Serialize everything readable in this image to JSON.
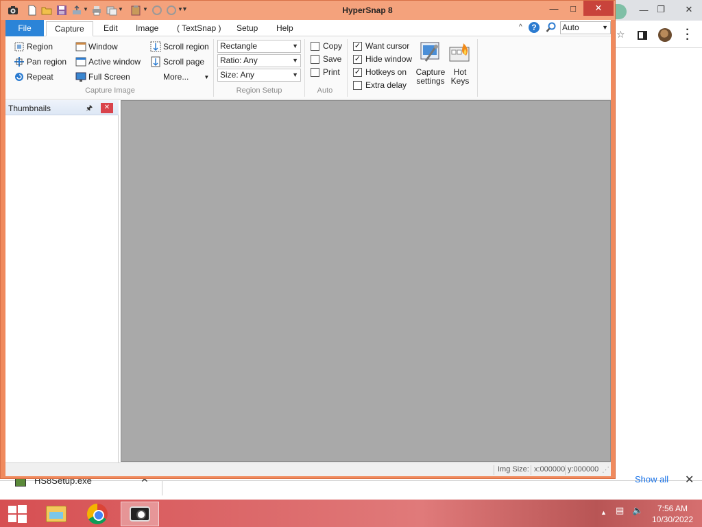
{
  "window": {
    "title": "HyperSnap 8"
  },
  "tabs": [
    {
      "label": "File"
    },
    {
      "label": "Capture"
    },
    {
      "label": "Edit"
    },
    {
      "label": "Image"
    },
    {
      "label": "( TextSnap )"
    },
    {
      "label": "Setup"
    },
    {
      "label": "Help"
    }
  ],
  "zoom": {
    "value": "Auto"
  },
  "capture_image": {
    "group_label": "Capture Image",
    "region": "Region",
    "pan_region": "Pan region",
    "repeat": "Repeat",
    "window": "Window",
    "active_window": "Active window",
    "full_screen": "Full Screen",
    "scroll_region": "Scroll region",
    "scroll_page": "Scroll page",
    "more": "More..."
  },
  "region_setup": {
    "group_label": "Region Setup",
    "shape": "Rectangle",
    "ratio": "Ratio: Any",
    "size": "Size: Any"
  },
  "auto": {
    "group_label": "Auto",
    "copy": {
      "label": "Copy",
      "checked": false
    },
    "save": {
      "label": "Save",
      "checked": false
    },
    "print": {
      "label": "Print",
      "checked": false
    }
  },
  "options": {
    "want_cursor": {
      "label": "Want cursor",
      "checked": true
    },
    "hide_window": {
      "label": "Hide window",
      "checked": true
    },
    "hotkeys_on": {
      "label": "Hotkeys on",
      "checked": true
    },
    "extra_delay": {
      "label": "Extra delay",
      "checked": false
    }
  },
  "big_buttons": {
    "capture_settings": {
      "line1": "Capture",
      "line2": "settings"
    },
    "hot_keys": {
      "line1": "Hot",
      "line2": "Keys"
    }
  },
  "thumbnails": {
    "title": "Thumbnails"
  },
  "status": {
    "img_size": "Img Size:",
    "x": "x:000000",
    "y": "y:000000"
  },
  "download_bar": {
    "file_name": "HS8Setup.exe",
    "show_all": "Show all"
  },
  "taskbar": {
    "time": "7:56 AM",
    "date": "10/30/2022"
  },
  "colors": {
    "accent": "#2b84d8",
    "window_border": "#f08a5d",
    "canvas": "#a9a9a9",
    "taskbar": "#d64f52"
  }
}
